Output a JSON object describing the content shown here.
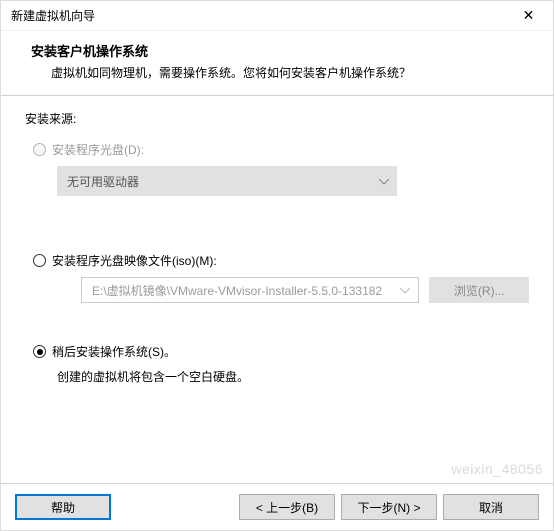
{
  "titlebar": {
    "title": "新建虚拟机向导",
    "close_glyph": "✕"
  },
  "header": {
    "heading": "安装客户机操作系统",
    "subheading": "虚拟机如同物理机，需要操作系统。您将如何安装客户机操作系统？"
  },
  "content": {
    "source_label": "安装来源:",
    "option_disc": {
      "label": "安装程序光盘(D):",
      "combo_text": "无可用驱动器",
      "enabled": false,
      "selected": false
    },
    "option_iso": {
      "label": "安装程序光盘映像文件(iso)(M):",
      "path": "E:\\虚拟机镜像\\VMware-VMvisor-Installer-5.5.0-133182",
      "browse_label": "浏览(R)...",
      "enabled": true,
      "selected": false
    },
    "option_later": {
      "label": "稍后安装操作系统(S)。",
      "note": "创建的虚拟机将包含一个空白硬盘。",
      "selected": true
    }
  },
  "footer": {
    "help": "帮助",
    "back": "< 上一步(B)",
    "next": "下一步(N) >",
    "cancel": "取消"
  },
  "watermark": "weixin_48056"
}
